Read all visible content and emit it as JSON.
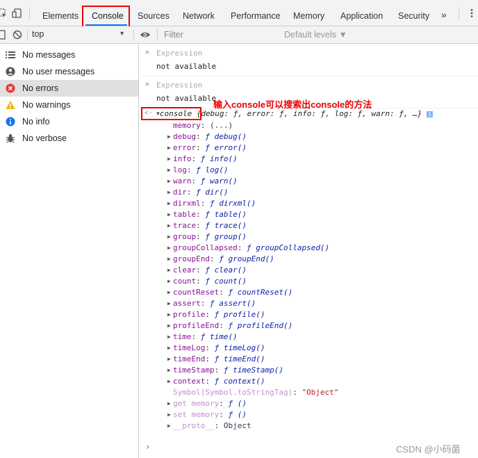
{
  "tabs": [
    "Elements",
    "Console",
    "Sources",
    "Network",
    "Performance",
    "Memory",
    "Application",
    "Security"
  ],
  "toolbar": {
    "context": "top",
    "filter_placeholder": "Filter",
    "levels": "Default levels ▼"
  },
  "sidebar": {
    "items": [
      {
        "label": "No messages",
        "icon": "list-icon"
      },
      {
        "label": "No user messages",
        "icon": "user-icon"
      },
      {
        "label": "No errors",
        "icon": "error-icon"
      },
      {
        "label": "No warnings",
        "icon": "warning-icon"
      },
      {
        "label": "No info",
        "icon": "info-icon"
      },
      {
        "label": "No verbose",
        "icon": "bug-icon"
      }
    ]
  },
  "expressions": [
    {
      "label": "Expression",
      "value": "not available"
    },
    {
      "label": "Expression",
      "value": "not available"
    }
  ],
  "annotation": "输入console可以搜索出console的方法",
  "console_result": {
    "name": "console",
    "summary": "{debug: ƒ, error: ƒ, info: ƒ, log: ƒ, warn: ƒ, …}",
    "properties": [
      {
        "key": "memory",
        "value": "(...)",
        "expandable": false,
        "type": "plain"
      },
      {
        "key": "debug",
        "value": "ƒ debug()",
        "expandable": true,
        "type": "func"
      },
      {
        "key": "error",
        "value": "ƒ error()",
        "expandable": true,
        "type": "func"
      },
      {
        "key": "info",
        "value": "ƒ info()",
        "expandable": true,
        "type": "func"
      },
      {
        "key": "log",
        "value": "ƒ log()",
        "expandable": true,
        "type": "func"
      },
      {
        "key": "warn",
        "value": "ƒ warn()",
        "expandable": true,
        "type": "func"
      },
      {
        "key": "dir",
        "value": "ƒ dir()",
        "expandable": true,
        "type": "func"
      },
      {
        "key": "dirxml",
        "value": "ƒ dirxml()",
        "expandable": true,
        "type": "func"
      },
      {
        "key": "table",
        "value": "ƒ table()",
        "expandable": true,
        "type": "func"
      },
      {
        "key": "trace",
        "value": "ƒ trace()",
        "expandable": true,
        "type": "func"
      },
      {
        "key": "group",
        "value": "ƒ group()",
        "expandable": true,
        "type": "func"
      },
      {
        "key": "groupCollapsed",
        "value": "ƒ groupCollapsed()",
        "expandable": true,
        "type": "func"
      },
      {
        "key": "groupEnd",
        "value": "ƒ groupEnd()",
        "expandable": true,
        "type": "func"
      },
      {
        "key": "clear",
        "value": "ƒ clear()",
        "expandable": true,
        "type": "func"
      },
      {
        "key": "count",
        "value": "ƒ count()",
        "expandable": true,
        "type": "func"
      },
      {
        "key": "countReset",
        "value": "ƒ countReset()",
        "expandable": true,
        "type": "func"
      },
      {
        "key": "assert",
        "value": "ƒ assert()",
        "expandable": true,
        "type": "func"
      },
      {
        "key": "profile",
        "value": "ƒ profile()",
        "expandable": true,
        "type": "func"
      },
      {
        "key": "profileEnd",
        "value": "ƒ profileEnd()",
        "expandable": true,
        "type": "func"
      },
      {
        "key": "time",
        "value": "ƒ time()",
        "expandable": true,
        "type": "func"
      },
      {
        "key": "timeLog",
        "value": "ƒ timeLog()",
        "expandable": true,
        "type": "func"
      },
      {
        "key": "timeEnd",
        "value": "ƒ timeEnd()",
        "expandable": true,
        "type": "func"
      },
      {
        "key": "timeStamp",
        "value": "ƒ timeStamp()",
        "expandable": true,
        "type": "func"
      },
      {
        "key": "context",
        "value": "ƒ context()",
        "expandable": true,
        "type": "func"
      },
      {
        "key": "Symbol(Symbol.toStringTag)",
        "value": "\"Object\"",
        "expandable": false,
        "type": "string"
      },
      {
        "key": "get memory",
        "value": "ƒ ()",
        "expandable": true,
        "type": "func"
      },
      {
        "key": "set memory",
        "value": "ƒ ()",
        "expandable": true,
        "type": "func"
      },
      {
        "key": "__proto__",
        "value": "Object",
        "expandable": true,
        "type": "plain"
      }
    ]
  },
  "watermark": "CSDN @小码菌",
  "colors": {
    "accent": "#1a73e8",
    "annotation": "#ee0000",
    "key": "#881391",
    "string": "#c41a16",
    "error": "#e53935",
    "warning": "#f4b400",
    "info": "#1a73e8"
  }
}
